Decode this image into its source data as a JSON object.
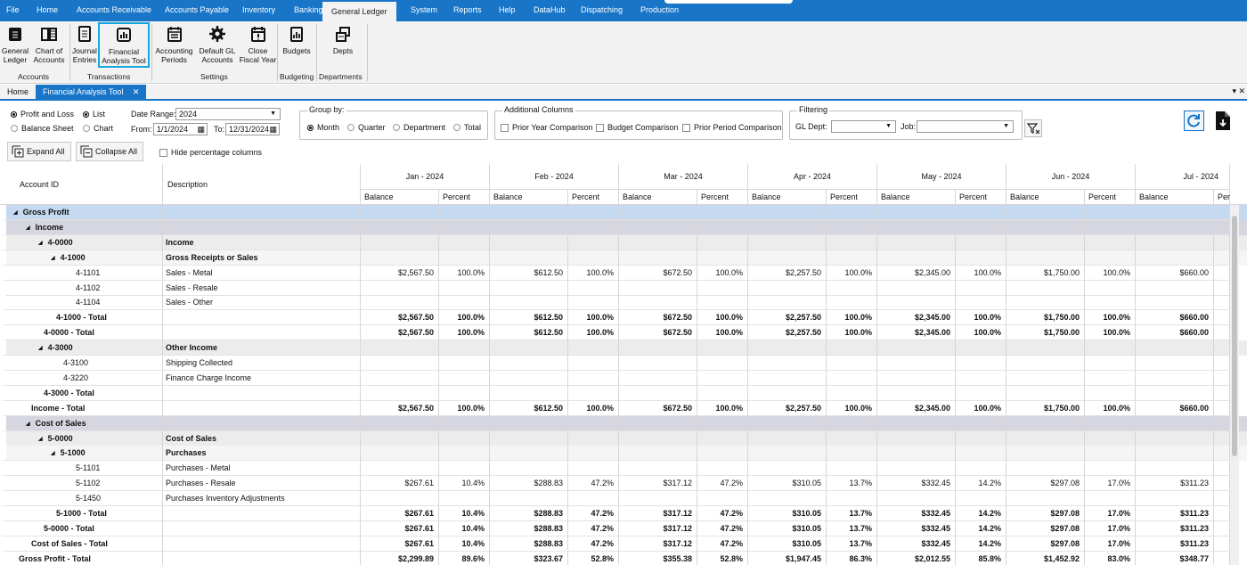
{
  "menu": [
    "File",
    "Home",
    "Accounts Receivable",
    "Accounts Payable",
    "Inventory",
    "Banking",
    "General Ledger",
    "System",
    "Reports",
    "Help",
    "DataHub",
    "Dispatching",
    "Production"
  ],
  "ribbon": {
    "buttons": [
      {
        "l1": "General",
        "l2": "Ledger",
        "icon": "general-ledger-icon"
      },
      {
        "l1": "Chart of",
        "l2": "Accounts",
        "icon": "book-icon"
      },
      {
        "l1": "Journal",
        "l2": "Entries",
        "icon": "journal-icon"
      },
      {
        "l1": "Financial",
        "l2": "Analysis Tool",
        "icon": "chart-icon"
      },
      {
        "l1": "Accounting",
        "l2": "Periods",
        "icon": "calendar-list-icon"
      },
      {
        "l1": "Default GL",
        "l2": "Accounts",
        "icon": "gear-icon"
      },
      {
        "l1": "Close",
        "l2": "Fiscal Year",
        "icon": "calendar-alert-icon"
      },
      {
        "l1": "Budgets",
        "l2": "",
        "icon": "budget-icon"
      },
      {
        "l1": "Depts",
        "l2": "",
        "icon": "departments-icon"
      }
    ],
    "groups": [
      "Accounts",
      "Transactions",
      "Settings",
      "Budgeting",
      "Departments"
    ]
  },
  "tabs": {
    "home": "Home",
    "active": "Financial Analysis Tool",
    "close": "✕"
  },
  "filters": {
    "report_type": {
      "pl": "Profit and Loss",
      "bs": "Balance Sheet",
      "list": "List",
      "chart": "Chart"
    },
    "date_range_label": "Date Range:",
    "date_range": "2024",
    "from_label": "From:",
    "from": "1/1/2024",
    "to_label": "To:",
    "to": "12/31/2024",
    "group_by": {
      "legend": "Group by:",
      "options": [
        "Month",
        "Quarter",
        "Department",
        "Total"
      ]
    },
    "additional": {
      "legend": "Additional Columns",
      "options": [
        "Prior Year Comparison",
        "Budget Comparison",
        "Prior Period Comparison"
      ]
    },
    "filtering": {
      "legend": "Filtering",
      "gl_dept_label": "GL Dept:",
      "job_label": "Job:"
    }
  },
  "toolbar": {
    "expand": "Expand All",
    "collapse": "Collapse All",
    "hide_pct": "Hide percentage columns"
  },
  "grid": {
    "col_account": "Account ID",
    "col_desc": "Description",
    "months": [
      "Jan - 2024",
      "Feb - 2024",
      "Mar - 2024",
      "Apr - 2024",
      "May - 2024",
      "Jun - 2024",
      "Jul - 2024"
    ],
    "sub_balance": "Balance",
    "sub_percent": "Percent",
    "sub_partial": "Per",
    "rows": [
      {
        "indent": 0,
        "exp": true,
        "id": "Gross Profit",
        "desc": "",
        "bold": true,
        "bg": "#c5daf0",
        "vals": []
      },
      {
        "indent": 1,
        "exp": true,
        "id": "Income",
        "desc": "",
        "bold": true,
        "bg": "#d6d6e0",
        "vals": []
      },
      {
        "indent": 2,
        "exp": true,
        "id": "4-0000",
        "desc": "Income",
        "bold": true,
        "bg": "#ececec",
        "vals": []
      },
      {
        "indent": 3,
        "exp": true,
        "id": "4-1000",
        "desc": "Gross Receipts or Sales",
        "bold": true,
        "bg": "#f5f5f5",
        "vals": []
      },
      {
        "indent": 4,
        "id": "4-1101",
        "desc": "Sales - Metal",
        "vals": [
          "$2,567.50",
          "100.0%",
          "$612.50",
          "100.0%",
          "$672.50",
          "100.0%",
          "$2,257.50",
          "100.0%",
          "$2,345.00",
          "100.0%",
          "$1,750.00",
          "100.0%",
          "$660.00"
        ]
      },
      {
        "indent": 4,
        "id": "4-1102",
        "desc": "Sales - Resale",
        "vals": []
      },
      {
        "indent": 4,
        "id": "4-1104",
        "desc": "Sales - Other",
        "vals": []
      },
      {
        "indent": 3,
        "id": "4-1000 - Total",
        "desc": "",
        "bold": true,
        "vals": [
          "$2,567.50",
          "100.0%",
          "$612.50",
          "100.0%",
          "$672.50",
          "100.0%",
          "$2,257.50",
          "100.0%",
          "$2,345.00",
          "100.0%",
          "$1,750.00",
          "100.0%",
          "$660.00"
        ]
      },
      {
        "indent": 2,
        "id": "4-0000 - Total",
        "desc": "",
        "bold": true,
        "vals": [
          "$2,567.50",
          "100.0%",
          "$612.50",
          "100.0%",
          "$672.50",
          "100.0%",
          "$2,257.50",
          "100.0%",
          "$2,345.00",
          "100.0%",
          "$1,750.00",
          "100.0%",
          "$660.00"
        ]
      },
      {
        "indent": 2,
        "exp": true,
        "id": "4-3000",
        "desc": "Other Income",
        "bold": true,
        "bg": "#ececec",
        "vals": []
      },
      {
        "indent": 3,
        "id": "4-3100",
        "desc": "Shipping Collected",
        "vals": []
      },
      {
        "indent": 3,
        "id": "4-3220",
        "desc": "Finance Charge Income",
        "vals": []
      },
      {
        "indent": 2,
        "id": "4-3000 - Total",
        "desc": "",
        "bold": true,
        "vals": []
      },
      {
        "indent": 1,
        "id": "Income - Total",
        "desc": "",
        "bold": true,
        "vals": [
          "$2,567.50",
          "100.0%",
          "$612.50",
          "100.0%",
          "$672.50",
          "100.0%",
          "$2,257.50",
          "100.0%",
          "$2,345.00",
          "100.0%",
          "$1,750.00",
          "100.0%",
          "$660.00"
        ]
      },
      {
        "indent": 1,
        "exp": true,
        "id": "Cost of Sales",
        "desc": "",
        "bold": true,
        "bg": "#d6d6e0",
        "vals": []
      },
      {
        "indent": 2,
        "exp": true,
        "id": "5-0000",
        "desc": "Cost of Sales",
        "bold": true,
        "bg": "#ececec",
        "vals": []
      },
      {
        "indent": 3,
        "exp": true,
        "id": "5-1000",
        "desc": "Purchases",
        "bold": true,
        "bg": "#f5f5f5",
        "vals": []
      },
      {
        "indent": 4,
        "id": "5-1101",
        "desc": "Purchases - Metal",
        "vals": []
      },
      {
        "indent": 4,
        "id": "5-1102",
        "desc": "Purchases - Resale",
        "vals": [
          "$267.61",
          "10.4%",
          "$288.83",
          "47.2%",
          "$317.12",
          "47.2%",
          "$310.05",
          "13.7%",
          "$332.45",
          "14.2%",
          "$297.08",
          "17.0%",
          "$311.23"
        ]
      },
      {
        "indent": 4,
        "id": "5-1450",
        "desc": "Purchases Inventory Adjustments",
        "vals": []
      },
      {
        "indent": 3,
        "id": "5-1000 - Total",
        "desc": "",
        "bold": true,
        "vals": [
          "$267.61",
          "10.4%",
          "$288.83",
          "47.2%",
          "$317.12",
          "47.2%",
          "$310.05",
          "13.7%",
          "$332.45",
          "14.2%",
          "$297.08",
          "17.0%",
          "$311.23"
        ]
      },
      {
        "indent": 2,
        "id": "5-0000 - Total",
        "desc": "",
        "bold": true,
        "vals": [
          "$267.61",
          "10.4%",
          "$288.83",
          "47.2%",
          "$317.12",
          "47.2%",
          "$310.05",
          "13.7%",
          "$332.45",
          "14.2%",
          "$297.08",
          "17.0%",
          "$311.23"
        ]
      },
      {
        "indent": 1,
        "id": "Cost of Sales - Total",
        "desc": "",
        "bold": true,
        "vals": [
          "$267.61",
          "10.4%",
          "$288.83",
          "47.2%",
          "$317.12",
          "47.2%",
          "$310.05",
          "13.7%",
          "$332.45",
          "14.2%",
          "$297.08",
          "17.0%",
          "$311.23"
        ]
      },
      {
        "indent": 0,
        "id": "Gross Profit - Total",
        "desc": "",
        "bold": true,
        "vals": [
          "$2,299.89",
          "89.6%",
          "$323.67",
          "52.8%",
          "$355.38",
          "52.8%",
          "$1,947.45",
          "86.3%",
          "$2,012.55",
          "85.8%",
          "$1,452.92",
          "83.0%",
          "$348.77"
        ]
      }
    ]
  },
  "colors": {
    "accent": "#1875c8",
    "ribbon_selected": "#16a4dc"
  }
}
